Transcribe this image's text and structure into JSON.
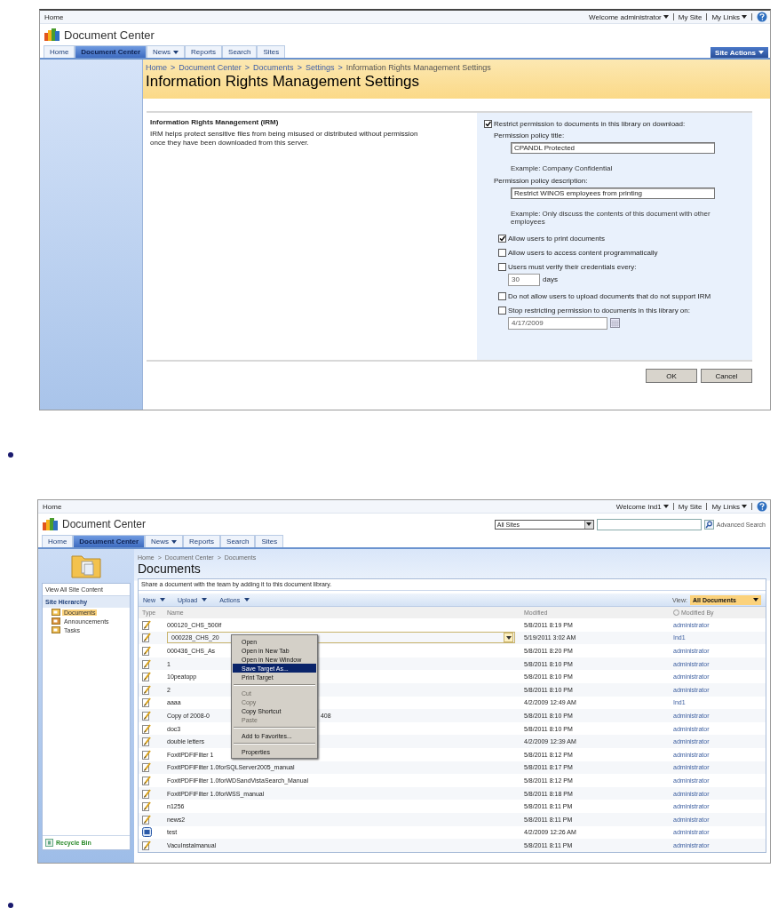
{
  "screen_1": {
    "top_bar": {
      "home": "Home",
      "welcome": "Welcome administrator",
      "my_site": "My Site",
      "my_links": "My Links"
    },
    "site_title": "Document Center",
    "tabs": [
      {
        "label": "Home",
        "selected": false,
        "menu": false
      },
      {
        "label": "Document Center",
        "selected": true,
        "menu": false
      },
      {
        "label": "News",
        "selected": false,
        "menu": true
      },
      {
        "label": "Reports",
        "selected": false,
        "menu": false
      },
      {
        "label": "Search",
        "selected": false,
        "menu": false
      },
      {
        "label": "Sites",
        "selected": false,
        "menu": false
      }
    ],
    "site_actions": "Site Actions",
    "breadcrumb": [
      "Home",
      "Document Center",
      "Documents",
      "Settings",
      "Information Rights Management Settings"
    ],
    "separator": ">",
    "page_title": "Information Rights Management Settings",
    "section": {
      "title": "Information Rights Management (IRM)",
      "description": "IRM helps protect sensitive files from being misused or distributed without permission once they have been downloaded from this server."
    },
    "restrict": {
      "label": "Restrict permission to documents in this library on download:",
      "checked": true
    },
    "policy_title": {
      "label": "Permission policy title:",
      "value": "CPANDL Protected",
      "example": "Example: Company Confidential"
    },
    "policy_description": {
      "label": "Permission policy description:",
      "value": "Restrict WINOS employees from printing",
      "example": "Example: Only discuss the contents of this document with other employees"
    },
    "options": [
      {
        "kind": "checkbox",
        "label": "Allow users to print documents",
        "checked": true
      },
      {
        "kind": "checkbox",
        "label": "Allow users to access content programmatically",
        "checked": false
      },
      {
        "kind": "interval",
        "label": "Users must verify their credentials every:",
        "checked": false,
        "value": "30",
        "unit": "days"
      },
      {
        "kind": "checkbox",
        "label": "Do not allow users to upload documents that do not support IRM",
        "checked": false
      },
      {
        "kind": "date",
        "label": "Stop restricting permission to documents in this library on:",
        "checked": false,
        "value": "4/17/2009"
      }
    ],
    "buttons": [
      "OK",
      "Cancel"
    ]
  },
  "screen_2": {
    "top_bar": {
      "home": "Home",
      "welcome": "Welcome Ind1",
      "my_site": "My Site",
      "my_links": "My Links"
    },
    "site_title": "Document Center",
    "search": {
      "scope": "All Sites",
      "advanced": "Advanced Search"
    },
    "tabs": [
      {
        "label": "Home",
        "selected": false,
        "menu": false
      },
      {
        "label": "Document Center",
        "selected": true,
        "menu": false
      },
      {
        "label": "News",
        "selected": false,
        "menu": true
      },
      {
        "label": "Reports",
        "selected": false,
        "menu": false
      },
      {
        "label": "Search",
        "selected": false,
        "menu": false
      },
      {
        "label": "Sites",
        "selected": false,
        "menu": false
      }
    ],
    "breadcrumb": [
      "Home",
      "Document Center",
      "Documents"
    ],
    "separator": ">",
    "page_title": "Documents",
    "nav": {
      "view_all": "View All Site Content",
      "heading": "Site Hierarchy",
      "items": [
        {
          "label": "Documents",
          "selected": true
        },
        {
          "label": "Announcements",
          "selected": false
        },
        {
          "label": "Tasks",
          "selected": false
        }
      ],
      "recycle_bin": "Recycle Bin"
    },
    "description": "Share a document with the team by adding it to this document library.",
    "toolbar": [
      "New",
      "Upload",
      "Actions"
    ],
    "view_label": "View:",
    "view": "All Documents",
    "columns": [
      "Type",
      "Name",
      "Modified",
      "Modified By"
    ],
    "rows": [
      {
        "kind": "page",
        "name": "000120_CHS_500lf",
        "modified": "5/8/2011 8:19 PM",
        "modified_by": "administrator",
        "selected": false
      },
      {
        "kind": "page",
        "name": "000228_CHS_20",
        "modified": "5/19/2011 3:02 AM",
        "modified_by": "Ind1",
        "selected": true
      },
      {
        "kind": "page",
        "name": "000436_CHS_As",
        "modified": "5/8/2011 8:20 PM",
        "modified_by": "administrator",
        "selected": false
      },
      {
        "kind": "page",
        "name": "1",
        "modified": "5/8/2011 8:10 PM",
        "modified_by": "administrator",
        "selected": false
      },
      {
        "kind": "page",
        "name": "10peatopp",
        "modified": "5/8/2011 8:10 PM",
        "modified_by": "administrator",
        "selected": false
      },
      {
        "kind": "page",
        "name": "2",
        "modified": "5/8/2011 8:10 PM",
        "modified_by": "administrator",
        "selected": false
      },
      {
        "kind": "page",
        "name": "aaaa",
        "modified": "4/2/2009 12:49 AM",
        "modified_by": "Ind1",
        "selected": false
      },
      {
        "kind": "page",
        "name": "Copy of 2008-0",
        "name_tail": "408",
        "modified": "5/8/2011 8:10 PM",
        "modified_by": "administrator",
        "selected": false
      },
      {
        "kind": "page",
        "name": "doc3",
        "modified": "5/8/2011 8:10 PM",
        "modified_by": "administrator",
        "selected": false
      },
      {
        "kind": "page",
        "name": "double letters",
        "modified": "4/2/2009 12:39 AM",
        "modified_by": "administrator",
        "selected": false
      },
      {
        "kind": "page",
        "name": "FoxitPDFIFilter 1",
        "modified": "5/8/2011 8:12 PM",
        "modified_by": "administrator",
        "selected": false
      },
      {
        "kind": "page",
        "name": "FoxitPDFIFilter 1.0forSQLServer2005_manual",
        "modified": "5/8/2011 8:17 PM",
        "modified_by": "administrator",
        "selected": false
      },
      {
        "kind": "page",
        "name": "FoxitPDFIFilter 1.0forWDSandVistaSearch_Manual",
        "modified": "5/8/2011 8:12 PM",
        "modified_by": "administrator",
        "selected": false
      },
      {
        "kind": "page",
        "name": "FoxitPDFIFilter 1.0forWSS_manual",
        "modified": "5/8/2011 8:18 PM",
        "modified_by": "administrator",
        "selected": false
      },
      {
        "kind": "page",
        "name": "n1256",
        "modified": "5/8/2011 8:11 PM",
        "modified_by": "administrator",
        "selected": false
      },
      {
        "kind": "page",
        "name": "news2",
        "modified": "5/8/2011 8:11 PM",
        "modified_by": "administrator",
        "selected": false
      },
      {
        "kind": "word",
        "name": "test",
        "modified": "4/2/2009 12:26 AM",
        "modified_by": "administrator",
        "selected": false
      },
      {
        "kind": "page",
        "name": "VacuInstalmanual",
        "modified": "5/8/2011 8:11 PM",
        "modified_by": "administrator",
        "selected": false
      }
    ],
    "context_menu": [
      {
        "kind": "item",
        "label": "Open",
        "disabled": false,
        "selected": false
      },
      {
        "kind": "item",
        "label": "Open in New Tab",
        "disabled": false,
        "selected": false
      },
      {
        "kind": "item",
        "label": "Open in New Window",
        "disabled": false,
        "selected": false
      },
      {
        "kind": "item",
        "label": "Save Target As...",
        "disabled": false,
        "selected": true
      },
      {
        "kind": "item",
        "label": "Print Target",
        "disabled": false,
        "selected": false
      },
      {
        "kind": "separator"
      },
      {
        "kind": "item",
        "label": "Cut",
        "disabled": true,
        "selected": false
      },
      {
        "kind": "item",
        "label": "Copy",
        "disabled": true,
        "selected": false
      },
      {
        "kind": "item",
        "label": "Copy Shortcut",
        "disabled": false,
        "selected": false
      },
      {
        "kind": "item",
        "label": "Paste",
        "disabled": true,
        "selected": false
      },
      {
        "kind": "separator"
      },
      {
        "kind": "item",
        "label": "Add to Favorites...",
        "disabled": false,
        "selected": false
      },
      {
        "kind": "separator"
      },
      {
        "kind": "item",
        "label": "Properties",
        "disabled": false,
        "selected": false
      }
    ]
  }
}
